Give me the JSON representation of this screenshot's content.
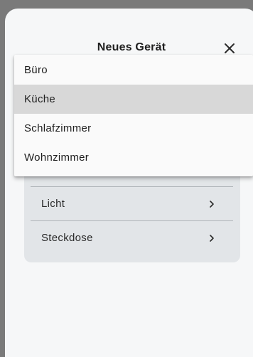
{
  "sheet": {
    "title": "Neues Gerät",
    "close_icon": "close-icon"
  },
  "device_types": {
    "items": [
      {
        "label": "Licht",
        "icon": "chevron-right-icon"
      },
      {
        "label": "Steckdose",
        "icon": "chevron-right-icon"
      }
    ]
  },
  "room_dropdown": {
    "selected": "Küche",
    "options": [
      "Büro",
      "Küche",
      "Schlafzimmer",
      "Wohnzimmer"
    ]
  },
  "colors": {
    "backdrop": "#7a7a7a",
    "sheet": "#f6f7f8",
    "card": "#e2e5e8",
    "selected_option": "#d8d8d8"
  }
}
